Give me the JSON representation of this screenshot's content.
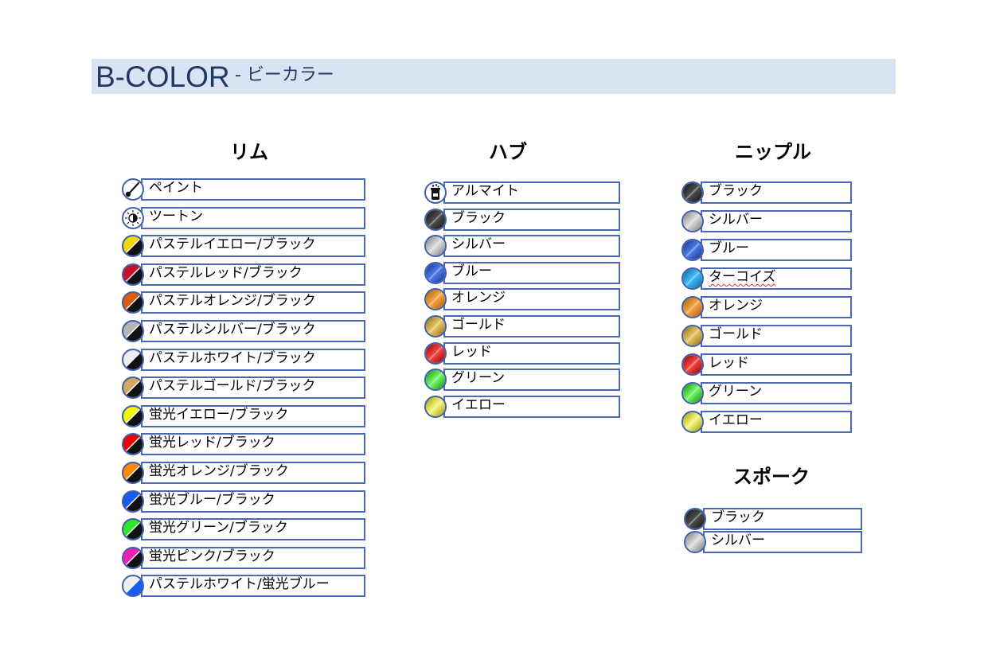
{
  "header": {
    "title": "B-COLOR",
    "subtitle": "- ビーカラー"
  },
  "rim": {
    "title": "リム",
    "items": [
      {
        "label": "ペイント",
        "icon": "paintbrush-icon",
        "type": "icon"
      },
      {
        "label": "ツートン",
        "icon": "two-tone-sun-icon",
        "type": "icon"
      },
      {
        "label": "パステルイエロー/ブラック",
        "type": "split",
        "color1": "#f2d600",
        "color2": "#111111"
      },
      {
        "label": "パステルレッド/ブラック",
        "type": "split",
        "color1": "#c8102e",
        "color2": "#111111"
      },
      {
        "label": "パステルオレンジ/ブラック",
        "type": "split",
        "color1": "#e05a0c",
        "color2": "#111111"
      },
      {
        "label": "パステルシルバー/ブラック",
        "type": "split",
        "color1": "#b5b5b5",
        "color2": "#111111"
      },
      {
        "label": "パステルホワイト/ブラック",
        "type": "split",
        "color1": "#eeeeee",
        "color2": "#111111"
      },
      {
        "label": "パステルゴールド/ブラック",
        "type": "split",
        "color1": "#d2a860",
        "color2": "#111111"
      },
      {
        "label": "蛍光イエロー/ブラック",
        "type": "split",
        "color1": "#f5f500",
        "color2": "#111111"
      },
      {
        "label": "蛍光レッド/ブラック",
        "type": "split",
        "color1": "#ee0000",
        "color2": "#111111"
      },
      {
        "label": "蛍光オレンジ/ブラック",
        "type": "split",
        "color1": "#ff8a00",
        "color2": "#111111"
      },
      {
        "label": "蛍光ブルー/ブラック",
        "type": "split",
        "color1": "#1a5af0",
        "color2": "#111111"
      },
      {
        "label": "蛍光グリーン/ブラック",
        "type": "split",
        "color1": "#2ee62e",
        "color2": "#111111"
      },
      {
        "label": "蛍光ピンク/ブラック",
        "type": "split",
        "color1": "#f020b4",
        "color2": "#111111"
      },
      {
        "label": "パステルホワイト/蛍光ブルー",
        "type": "split",
        "color1": "#eeeeee",
        "color2": "#1a5af0"
      }
    ]
  },
  "hub": {
    "title": "ハブ",
    "items": [
      {
        "label": "アルマイト",
        "icon": "anodize-beaker-icon",
        "type": "icon"
      },
      {
        "label": "ブラック",
        "type": "metal",
        "color1": "#4a4a4a",
        "color2": "#111111"
      },
      {
        "label": "シルバー",
        "type": "metal",
        "color1": "#d6d6d6",
        "color2": "#7a7a7a"
      },
      {
        "label": "ブルー",
        "type": "metal",
        "color1": "#4a78e0",
        "color2": "#12308c"
      },
      {
        "label": "オレンジ",
        "type": "metal",
        "color1": "#f0a040",
        "color2": "#a85a00"
      },
      {
        "label": "ゴールド",
        "type": "metal",
        "color1": "#e2c060",
        "color2": "#8a6a10"
      },
      {
        "label": "レッド",
        "type": "metal",
        "color1": "#f04040",
        "color2": "#8c0000"
      },
      {
        "label": "グリーン",
        "type": "metal",
        "color1": "#70f060",
        "color2": "#108c10"
      },
      {
        "label": "イエロー",
        "type": "metal",
        "color1": "#f0f070",
        "color2": "#9a9a10"
      }
    ]
  },
  "nipple": {
    "title": "ニップル",
    "items": [
      {
        "label": "ブラック",
        "type": "metal",
        "color1": "#4a4a4a",
        "color2": "#111111"
      },
      {
        "label": "シルバー",
        "type": "metal",
        "color1": "#d6d6d6",
        "color2": "#7a7a7a"
      },
      {
        "label": "ブルー",
        "type": "metal",
        "color1": "#4a78e0",
        "color2": "#12308c"
      },
      {
        "label": "ターコイズ",
        "type": "metal",
        "color1": "#40b8f0",
        "color2": "#0a6090",
        "spell": true
      },
      {
        "label": "オレンジ",
        "type": "metal",
        "color1": "#f0a040",
        "color2": "#a85a00"
      },
      {
        "label": "ゴールド",
        "type": "metal",
        "color1": "#e2c060",
        "color2": "#8a6a10"
      },
      {
        "label": "レッド",
        "type": "metal",
        "color1": "#f04040",
        "color2": "#8c0000"
      },
      {
        "label": "グリーン",
        "type": "metal",
        "color1": "#70f060",
        "color2": "#108c10"
      },
      {
        "label": "イエロー",
        "type": "metal",
        "color1": "#f0f070",
        "color2": "#9a9a10"
      }
    ]
  },
  "spoke": {
    "title": "スポーク",
    "items": [
      {
        "label": "ブラック",
        "type": "metal",
        "color1": "#4a4a4a",
        "color2": "#111111"
      },
      {
        "label": "シルバー",
        "type": "metal",
        "color1": "#d6d6d6",
        "color2": "#7a7a7a"
      }
    ]
  }
}
